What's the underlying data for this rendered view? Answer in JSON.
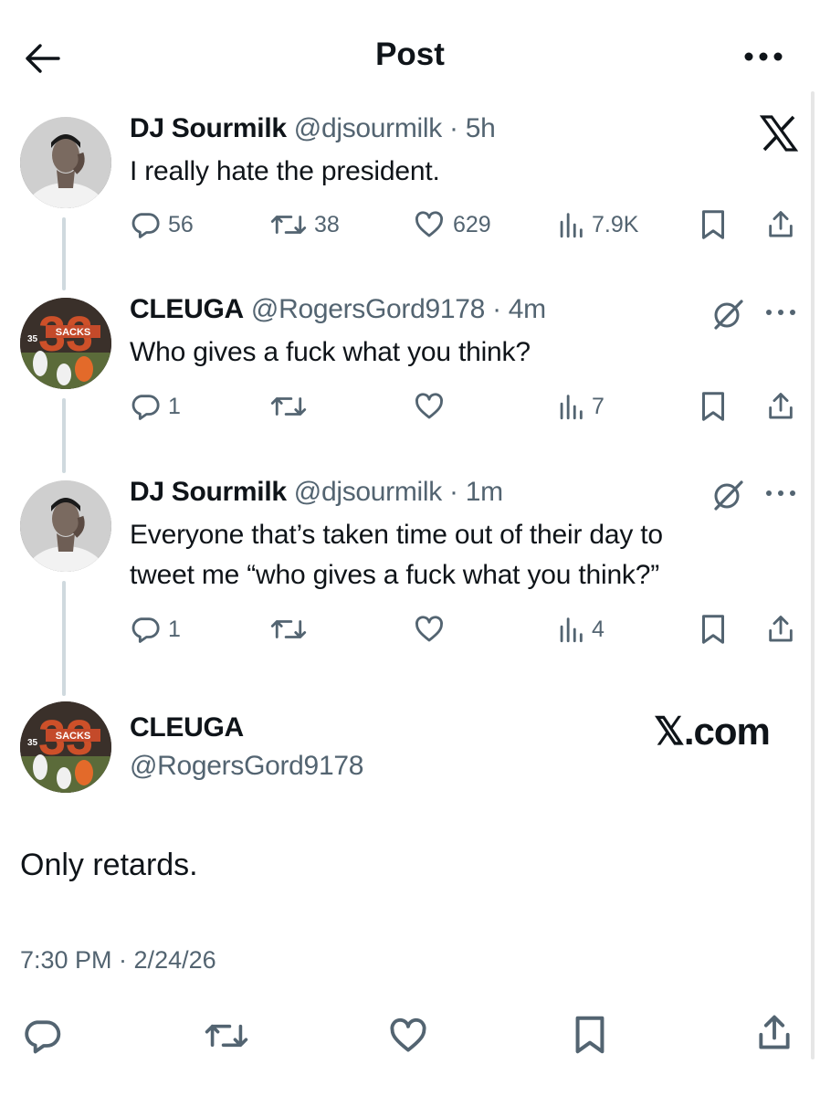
{
  "header": {
    "title": "Post"
  },
  "tweets": [
    {
      "name": "DJ Sourmilk",
      "handle": "@djsourmilk",
      "time": "5h",
      "text_lines": [
        "I really hate the president."
      ],
      "replies": "56",
      "reposts": "38",
      "likes": "629",
      "views": "7.9K"
    },
    {
      "name": "CLEUGA",
      "handle": "@RogersGord9178",
      "time": "4m",
      "text_lines": [
        "Who gives a fuck what you think?"
      ],
      "replies": "1",
      "reposts": "",
      "likes": "",
      "views": "7"
    },
    {
      "name": "DJ Sourmilk",
      "handle": "@djsourmilk",
      "time": "1m",
      "text_lines": [
        "Everyone that’s taken time out of their day to",
        "tweet me “who gives a fuck what you think?”"
      ],
      "replies": "1",
      "reposts": "",
      "likes": "",
      "views": "4"
    }
  ],
  "main_post": {
    "name": "CLEUGA",
    "handle": "@RogersGord9178",
    "text": "Only retards.",
    "timestamp": "7:30 PM · 2/24/26",
    "watermark": "𝕏.com"
  },
  "avatar_text": {
    "sacks": "SACKS",
    "number": "35"
  },
  "colors": {
    "text": "#0f1419",
    "secondary": "#536471",
    "thread_line": "#cfd9de"
  },
  "icons": [
    "arrow-left-icon",
    "more-icon",
    "x-logo-icon",
    "reply-icon",
    "repost-icon",
    "like-icon",
    "views-icon",
    "bookmark-icon",
    "share-icon",
    "grok-icon"
  ]
}
